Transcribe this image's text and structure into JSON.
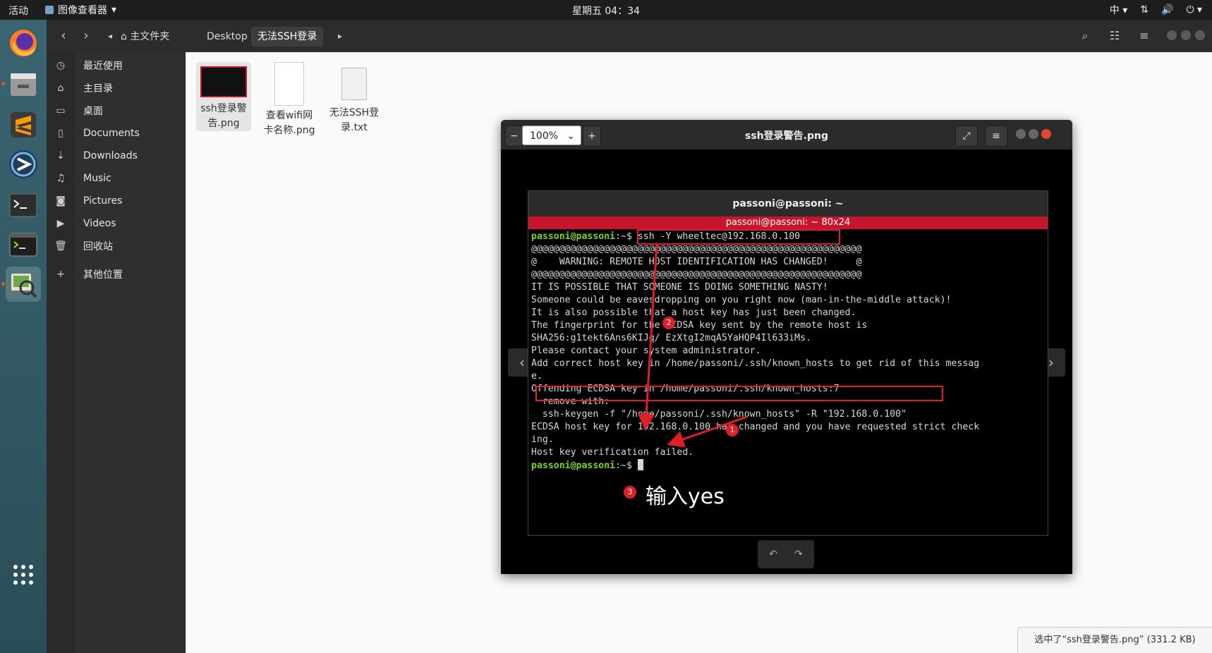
{
  "topbar": {
    "activities": "活动",
    "app_menu": "图像查看器",
    "clock": "星期五 04：34",
    "input_method": "中"
  },
  "dock": {
    "items": [
      "firefox-icon",
      "files-icon",
      "sublime-text-icon",
      "app-icon",
      "terminal-icon",
      "terminal-2-icon",
      "image-viewer-icon",
      "show-apps-icon"
    ]
  },
  "nautilus": {
    "breadcrumbs": [
      "主文件夹",
      "Desktop",
      "无法SSH登录"
    ],
    "sidebar": [
      {
        "label": "最近使用",
        "icon": "clock-icon"
      },
      {
        "label": "主目录",
        "icon": "home-icon"
      },
      {
        "label": "桌面",
        "icon": "folder-icon"
      },
      {
        "label": "Documents",
        "icon": "document-icon"
      },
      {
        "label": "Downloads",
        "icon": "download-icon"
      },
      {
        "label": "Music",
        "icon": "music-icon"
      },
      {
        "label": "Pictures",
        "icon": "camera-icon"
      },
      {
        "label": "Videos",
        "icon": "video-icon"
      },
      {
        "label": "回收站",
        "icon": "trash-icon"
      },
      {
        "label": "其他位置",
        "icon": "plus-icon"
      }
    ],
    "files": [
      {
        "line1": "ssh登录警",
        "line2": "告.png"
      },
      {
        "line1": "查看wifi网",
        "line2": "卡名称.png"
      },
      {
        "line1": "无法SSH登",
        "line2": "录.txt"
      }
    ],
    "status": "选中了“ssh登录警告.png” (331.2 KB)"
  },
  "viewer": {
    "title": "ssh登录警告.png",
    "zoom": "100%",
    "terminal": {
      "title": "passoni@passoni: ~",
      "tab": "passoni@passoni: ~ 80x24",
      "prompt": "passoni@passoni",
      "prompt_suffix": ":~$",
      "command": " ssh -Y wheeltec@192.168.0.100",
      "lines": [
        "@@@@@@@@@@@@@@@@@@@@@@@@@@@@@@@@@@@@@@@@@@@@@@@@@@@@@@@@@@@",
        "@    WARNING: REMOTE HOST IDENTIFICATION HAS CHANGED!     @",
        "@@@@@@@@@@@@@@@@@@@@@@@@@@@@@@@@@@@@@@@@@@@@@@@@@@@@@@@@@@@",
        "IT IS POSSIBLE THAT SOMEONE IS DOING SOMETHING NASTY!",
        "Someone could be eavesdropping on you right now (man-in-the-middle attack)!",
        "It is also possible that a host key has just been changed.",
        "The fingerprint for the ECDSA key sent by the remote host is",
        "SHA256:g1tekt6Ans6KIJq/ EzXtgI2mqA5YaHQP4Il633iMs.",
        "Please contact your system administrator.",
        "Add correct host key in /home/passoni/.ssh/known_hosts to get rid of this messag",
        "e.",
        "Offending ECDSA key in /home/passoni/.ssh/known_hosts:7",
        "  remove with:",
        "  ssh-keygen -f \"/home/passoni/.ssh/known_hosts\" -R \"192.168.0.100\"",
        "ECDSA host key for 192.168.0.100 has changed and you have requested strict check",
        "ing.",
        "Host key verification failed."
      ]
    },
    "annotations": {
      "badge1": "1",
      "badge2": "2",
      "badge3": "3",
      "note": "输入yes"
    }
  }
}
